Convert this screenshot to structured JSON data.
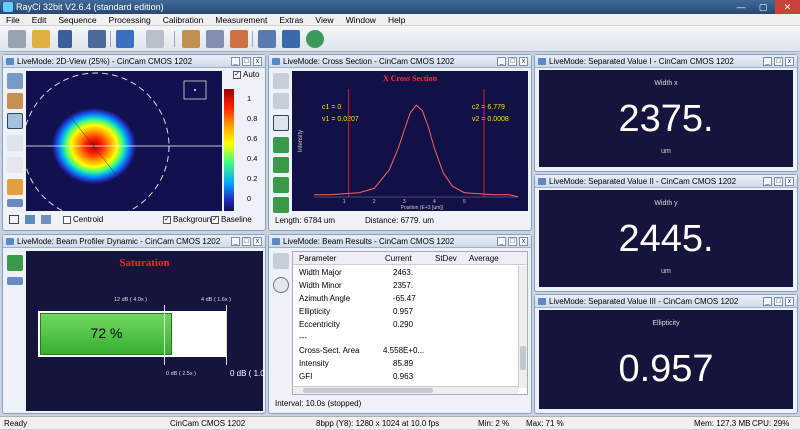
{
  "window": {
    "title": "RayCi 32bit V2.6.4 (standard edition)"
  },
  "menu": [
    "File",
    "Edit",
    "Sequence",
    "Processing",
    "Calibration",
    "Measurement",
    "Extras",
    "View",
    "Window",
    "Help"
  ],
  "panels": {
    "view2d": {
      "title": "LiveMode: 2D-View (25%) - CinCam CMOS 1202",
      "auto_label": "Auto",
      "scale_ticks": [
        "1",
        "0.8",
        "0.6",
        "0.4",
        "0.2",
        "0"
      ],
      "centroid": "Centroid",
      "background": "Background",
      "baseline": "Baseline"
    },
    "cross": {
      "title": "LiveMode: Cross Section - CinCam CMOS 1202",
      "chart_title": "X Cross Section",
      "c1": "c1 = 0",
      "v1": "v1 = 0.0207",
      "c2": "c2 = 6.779",
      "v2": "v2 = 0.0008",
      "ylabel": "Intensity",
      "xlabel": "Position (E+3 [um])",
      "xticks": [
        "1",
        "2",
        "3",
        "4",
        "5"
      ],
      "length": "Length: 6784 um",
      "distance": "Distance: 6779. um"
    },
    "sep1": {
      "title": "LiveMode: Separated Value I - CinCam CMOS 1202",
      "label": "Width x",
      "value": "2375.",
      "unit": "um"
    },
    "sep2": {
      "title": "LiveMode: Separated Value II - CinCam CMOS 1202",
      "label": "Width y",
      "value": "2445.",
      "unit": "um"
    },
    "sep3": {
      "title": "LiveMode: Separated Value III - CinCam CMOS 1202",
      "label": "Ellipticity",
      "value": "0.957",
      "unit": ""
    },
    "dynamic": {
      "title": "LiveMode: Beam Profiler Dynamic - CinCam CMOS 1202",
      "saturation": "Saturation",
      "top_left": "12 dB ( 4.0x )",
      "top_right": "4 dB ( 1.6x )",
      "bottom_mid": "0 dB ( 2.5x )",
      "bottom_right": "0 dB ( 1.0",
      "percent": "72 %"
    },
    "results": {
      "title": "LiveMode: Beam Results - CinCam CMOS 1202",
      "headers": [
        "Parameter",
        "Current",
        "StDev",
        "Average"
      ],
      "rows": [
        [
          "Width Major",
          "2463."
        ],
        [
          "Width Minor",
          "2357."
        ],
        [
          "Azimuth Angle",
          "-65.47"
        ],
        [
          "Ellipticity",
          "0.957"
        ],
        [
          "Eccentricity",
          "0.290"
        ],
        [
          "---",
          ""
        ],
        [
          "Cross-Sect. Area",
          "4.558E+0..."
        ],
        [
          "Intensity",
          "85.89"
        ],
        [
          "GFI",
          "0.963"
        ]
      ],
      "interval": "Interval: 10.0s (stopped)"
    }
  },
  "status": {
    "ready": "Ready",
    "camera": "CinCam CMOS 1202",
    "format": "8bpp (Y8): 1280 x 1024 at 10.0 fps",
    "min": "Min:  2 %",
    "max": "Max:  71 %",
    "mem": "Mem: 127.3 MB",
    "cpu": "CPU: 29%"
  },
  "progress": {
    "fraction": 0.72
  },
  "chart_data": {
    "type": "line",
    "title": "X Cross Section",
    "xlabel": "Position (E+3 [um])",
    "ylabel": "Intensity",
    "x": [
      0,
      0.5,
      1,
      1.5,
      2,
      2.5,
      2.8,
      3.0,
      3.2,
      3.4,
      3.6,
      3.8,
      4.0,
      4.3,
      4.6,
      5,
      5.5,
      6,
      6.5,
      6.78
    ],
    "values": [
      0.02,
      0.02,
      0.03,
      0.04,
      0.08,
      0.25,
      0.45,
      0.62,
      0.78,
      0.85,
      0.8,
      0.65,
      0.45,
      0.22,
      0.1,
      0.04,
      0.03,
      0.02,
      0.02,
      0.001
    ],
    "xlim": [
      0,
      6.78
    ],
    "ylim": [
      0,
      1
    ],
    "cursors": [
      1.15,
      5.65
    ]
  }
}
